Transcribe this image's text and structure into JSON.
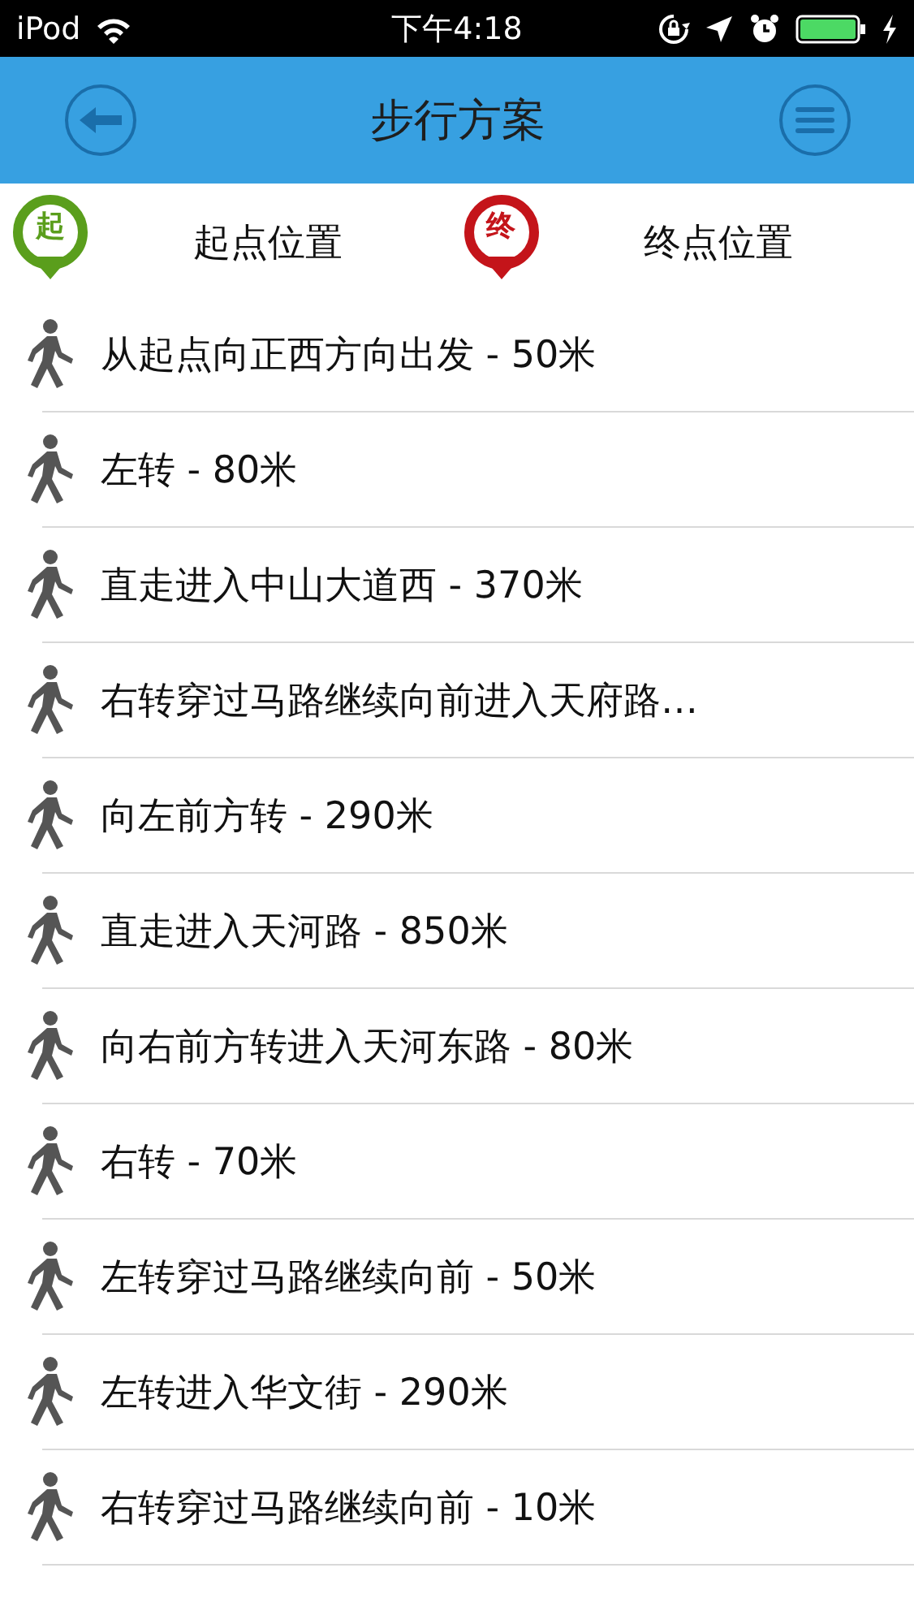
{
  "status_bar": {
    "carrier": "iPod",
    "time": "下午4:18"
  },
  "nav_bar": {
    "title": "步行方案"
  },
  "endpoints": [
    {
      "kind": "start",
      "pin": "起",
      "label": "起点位置"
    },
    {
      "kind": "end",
      "pin": "终",
      "label": "终点位置"
    }
  ],
  "steps": [
    {
      "text": "从起点向正西方向出发 - 50米"
    },
    {
      "text": "左转 - 80米"
    },
    {
      "text": "直走进入中山大道西 - 370米"
    },
    {
      "text": "右转穿过马路继续向前进入天府路…"
    },
    {
      "text": "向左前方转 - 290米"
    },
    {
      "text": "直走进入天河路 - 850米"
    },
    {
      "text": "向右前方转进入天河东路 - 80米"
    },
    {
      "text": "右转 - 70米"
    },
    {
      "text": "左转穿过马路继续向前 - 50米"
    },
    {
      "text": "左转进入华文街 - 290米"
    },
    {
      "text": "右转穿过马路继续向前 - 10米"
    }
  ]
}
